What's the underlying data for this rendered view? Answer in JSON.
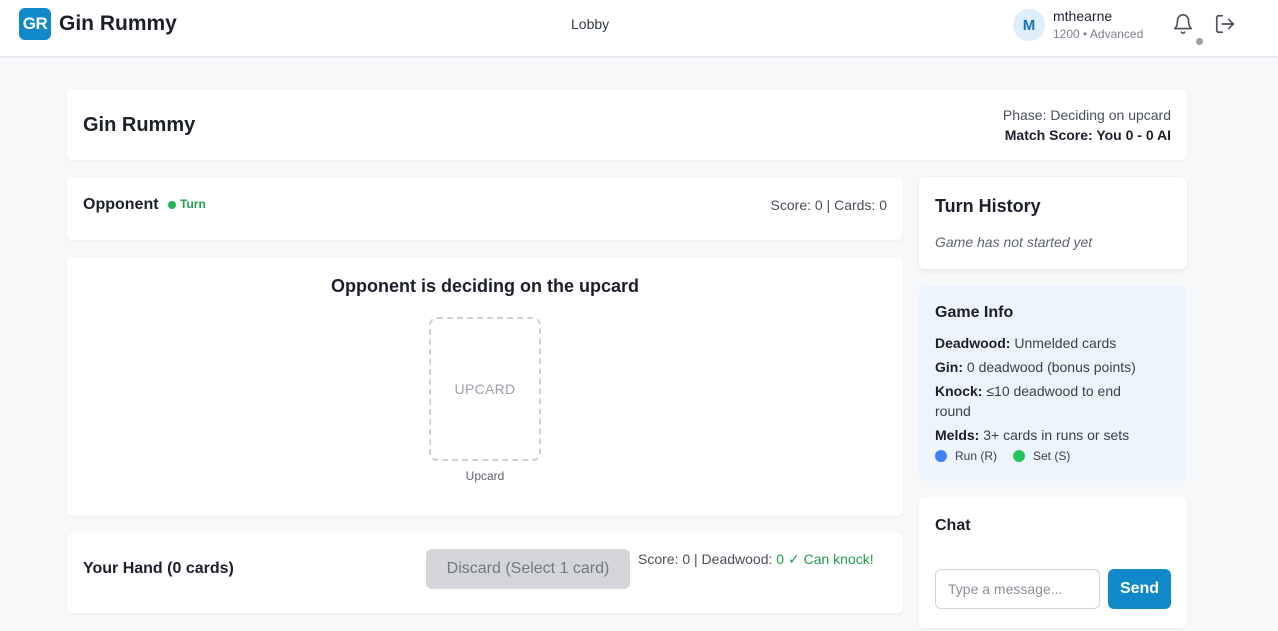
{
  "header": {
    "logo_text": "GR",
    "brand": "Gin Rummy",
    "nav_lobby": "Lobby",
    "user": {
      "avatar_initial": "M",
      "name": "mthearne",
      "meta": "1200 • Advanced"
    },
    "icons": [
      "bell-icon",
      "logout-icon"
    ]
  },
  "game": {
    "title": "Gin Rummy",
    "phase": "Phase: Deciding on upcard",
    "match_score": "Match Score: You 0 - 0 AI"
  },
  "opponent": {
    "label": "Opponent",
    "turn_label": "Turn",
    "stats": "Score: 0 | Cards: 0"
  },
  "table": {
    "status": "Opponent is deciding on the upcard",
    "upcard_placeholder": "UPCARD",
    "upcard_caption": "Upcard"
  },
  "hand": {
    "title": "Your Hand (0 cards)",
    "discard_label": "Discard (Select 1 card)",
    "stats_prefix": "Score: 0 | Deadwood: ",
    "stats_highlight": "0 ✓ Can knock!"
  },
  "history": {
    "title": "Turn History",
    "empty": "Game has not started yet"
  },
  "info": {
    "title": "Game Info",
    "lines": [
      {
        "term": "Deadwood:",
        "desc": " Unmelded cards"
      },
      {
        "term": "Gin:",
        "desc": " 0 deadwood (bonus points)"
      },
      {
        "term": "Knock:",
        "desc": " ≤10 deadwood to end round"
      },
      {
        "term": "Melds:",
        "desc": " 3+ cards in runs or sets"
      }
    ],
    "legend": [
      {
        "label": "Run (R)",
        "color": "#3b82f6"
      },
      {
        "label": "Set (S)",
        "color": "#22c55e"
      }
    ]
  },
  "chat": {
    "title": "Chat",
    "placeholder": "Type a message...",
    "send_label": "Send"
  },
  "colors": {
    "accent": "#1188c9",
    "turn_green": "#22b55a",
    "info_bg": "#eef4fd"
  }
}
